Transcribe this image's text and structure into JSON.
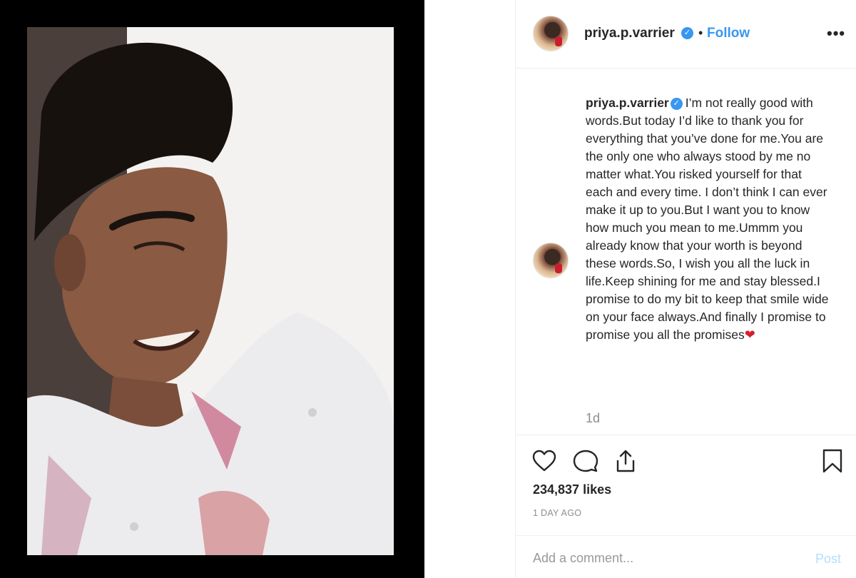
{
  "header": {
    "username": "priya.p.varrier",
    "verified_glyph": "✓",
    "separator": "•",
    "follow_label": "Follow",
    "more_icon": "•••"
  },
  "caption": {
    "username": "priya.p.varrier",
    "verified_glyph": "✓",
    "text": "I’m not really good with words.But today I’d like to thank you for everything that you’ve done for me.You are the only one who always stood by me no matter what.You risked yourself for that each and every time. I don’t think I can ever make it up to you.But I want you to know how much you mean to me.Ummm you already know that your worth is beyond these words.So, I wish you all the luck in life.Keep shining for me and stay blessed.I promise to do my bit to keep that smile wide on your face always.And finally I promise to promise you all the promises",
    "emoji": "❤",
    "time": "1d"
  },
  "actions": {
    "like_icon": "heart-outline-icon",
    "comment_icon": "comment-bubble-icon",
    "share_icon": "share-upload-icon",
    "save_icon": "bookmark-icon"
  },
  "likes": "234,837 likes",
  "date": "1 DAY AGO",
  "comment": {
    "placeholder": "Add a comment...",
    "post_label": "Post"
  },
  "colors": {
    "accent": "#3897f0",
    "text": "#262626",
    "muted": "#8e8e8e",
    "post_disabled": "#b2dffc",
    "border": "#efefef"
  }
}
